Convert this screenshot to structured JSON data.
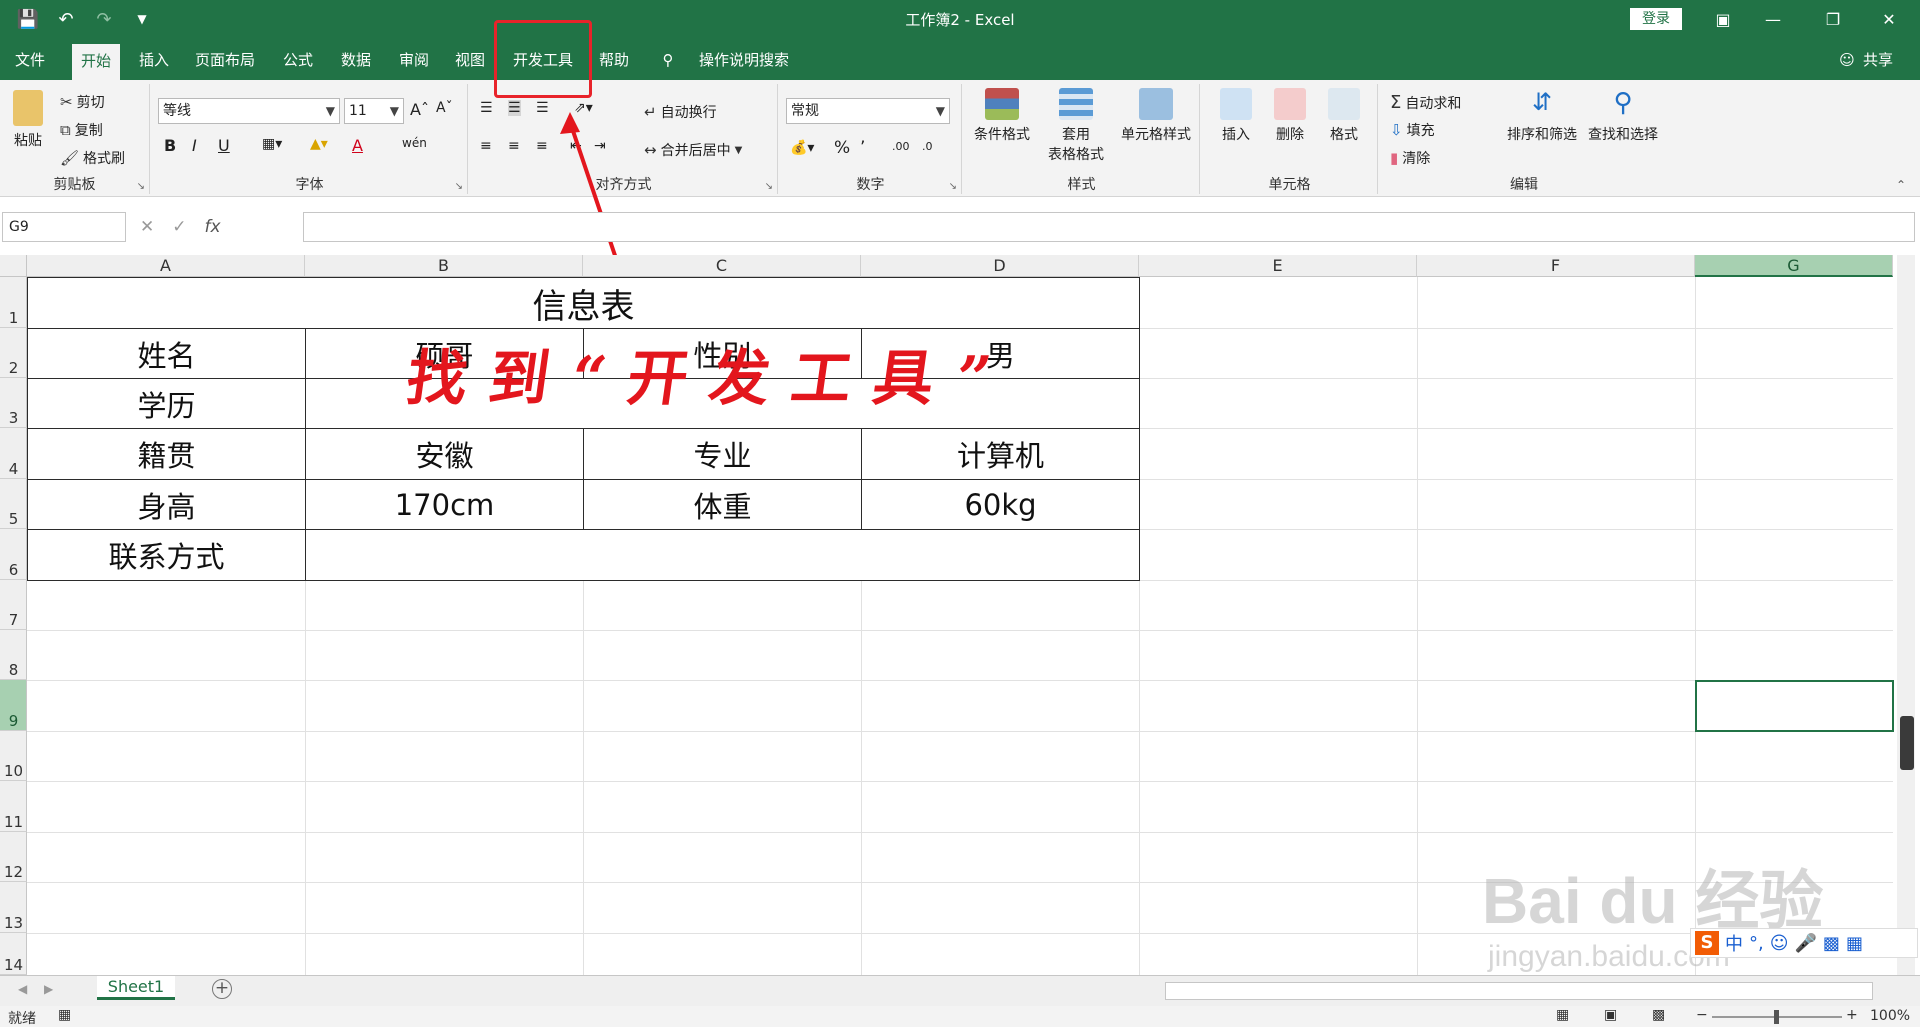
{
  "window": {
    "title": "工作簿2  -  Excel",
    "login": "登录"
  },
  "quick_access": [
    "save-icon",
    "undo-icon",
    "redo-icon",
    "customize-icon"
  ],
  "tabs": [
    {
      "label": "文件"
    },
    {
      "label": "开始"
    },
    {
      "label": "插入"
    },
    {
      "label": "页面布局"
    },
    {
      "label": "公式"
    },
    {
      "label": "数据"
    },
    {
      "label": "审阅"
    },
    {
      "label": "视图"
    },
    {
      "label": "开发工具"
    },
    {
      "label": "帮助"
    }
  ],
  "tell_me": "操作说明搜索",
  "share": "共享",
  "ribbon": {
    "clipboard": {
      "paste": "粘贴",
      "cut": "剪切",
      "copy": "复制",
      "format_painter": "格式刷",
      "label": "剪贴板"
    },
    "font": {
      "name": "等线",
      "size": "11",
      "label": "字体",
      "bold": "B",
      "italic": "I",
      "underline": "U",
      "font_color": "A",
      "phonetic": "wén"
    },
    "alignment": {
      "wrap": "自动换行",
      "merge": "合并后居中",
      "label": "对齐方式"
    },
    "number": {
      "format": "常规",
      "label": "数字",
      "percent": "%",
      "comma": "’",
      "inc_decimal": ".00",
      "dec_decimal": ".0"
    },
    "styles": {
      "conditional": "条件格式",
      "table_format_1": "套用",
      "table_format_2": "表格格式",
      "cell_styles": "单元格样式",
      "label": "样式"
    },
    "cells": {
      "insert": "插入",
      "delete": "删除",
      "format": "格式",
      "label": "单元格"
    },
    "editing": {
      "autosum": "自动求和",
      "fill": "填充",
      "clear": "清除",
      "sort": "排序和筛选",
      "find": "查找和选择",
      "label": "编辑"
    }
  },
  "formula_bar": {
    "name_box": "G9",
    "fx": "fx",
    "value": ""
  },
  "columns": [
    "A",
    "B",
    "C",
    "D",
    "E",
    "F",
    "G"
  ],
  "rows": [
    "1",
    "2",
    "3",
    "4",
    "5",
    "6",
    "7",
    "8",
    "9",
    "10",
    "11",
    "12",
    "13",
    "14"
  ],
  "table": {
    "title": "信息表",
    "r2": {
      "a": "姓名",
      "b": "硕哥",
      "c": "性别",
      "d": "男"
    },
    "r3": {
      "a": "学历"
    },
    "r4": {
      "a": "籍贯",
      "b": "安徽",
      "c": "专业",
      "d": "计算机"
    },
    "r5": {
      "a": "身高",
      "b": "170cm",
      "c": "体重",
      "d": "60kg"
    },
    "r6": {
      "a": "联系方式"
    }
  },
  "annotation": "找到“开发工具”",
  "sheet_tab": "Sheet1",
  "status": {
    "ready": "就绪",
    "zoom": "100%"
  },
  "watermark": {
    "brand": "Bai du 经验",
    "url": "jingyan.baidu.com"
  },
  "ime": {
    "mode": "中"
  },
  "colors": {
    "excel_green": "#217346",
    "annotation_red": "#e3161d"
  }
}
